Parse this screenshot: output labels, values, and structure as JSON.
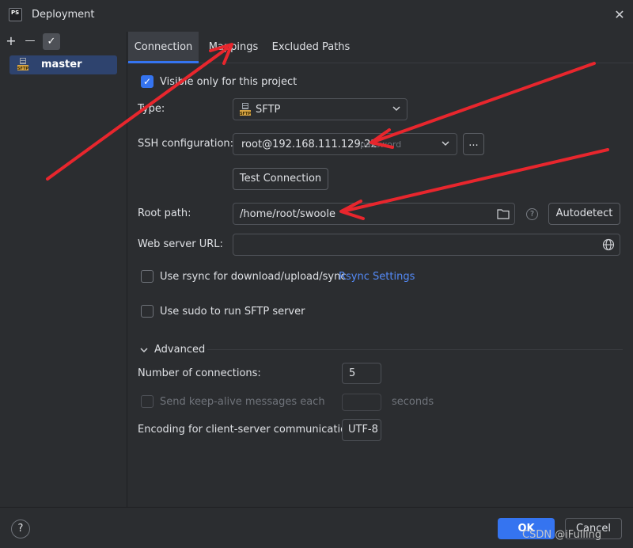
{
  "window": {
    "title": "Deployment",
    "logo_text": "PS"
  },
  "left": {
    "server_name": "master",
    "add_glyph": "+",
    "remove_glyph": "—",
    "check_glyph": "✓"
  },
  "tabs": [
    {
      "label": "Connection"
    },
    {
      "label": "Mappings"
    },
    {
      "label": "Excluded Paths"
    }
  ],
  "connection": {
    "visible_only_label": "Visible only for this project",
    "type_label": "Type:",
    "type_value": "SFTP",
    "ssh_label": "SSH configuration:",
    "ssh_value": "root@192.168.111.129:22",
    "ssh_hint": "password",
    "ellipsis_label": "...",
    "test_connection_label": "Test Connection",
    "root_path_label": "Root path:",
    "root_path_value": "/home/root/swoole",
    "autodetect_label": "Autodetect",
    "web_url_label": "Web server URL:",
    "web_url_value": "",
    "rsync_label": "Use rsync for download/upload/sync",
    "rsync_settings_label": "Rsync Settings",
    "sudo_label": "Use sudo to run SFTP server",
    "advanced_label": "Advanced",
    "connections_label": "Number of connections:",
    "connections_value": "5",
    "keepalive_label": "Send keep-alive messages each",
    "keepalive_value": "",
    "seconds_label": "seconds",
    "encoding_label": "Encoding for client-server communication:",
    "encoding_value": "UTF-8"
  },
  "footer": {
    "help_label": "?",
    "ok_label": "OK",
    "cancel_label": "Cancel",
    "watermark": "CSDN @iFulling"
  },
  "colors": {
    "accent": "#3574f0",
    "background": "#2b2d30",
    "annotation_arrow": "#e8262d"
  }
}
